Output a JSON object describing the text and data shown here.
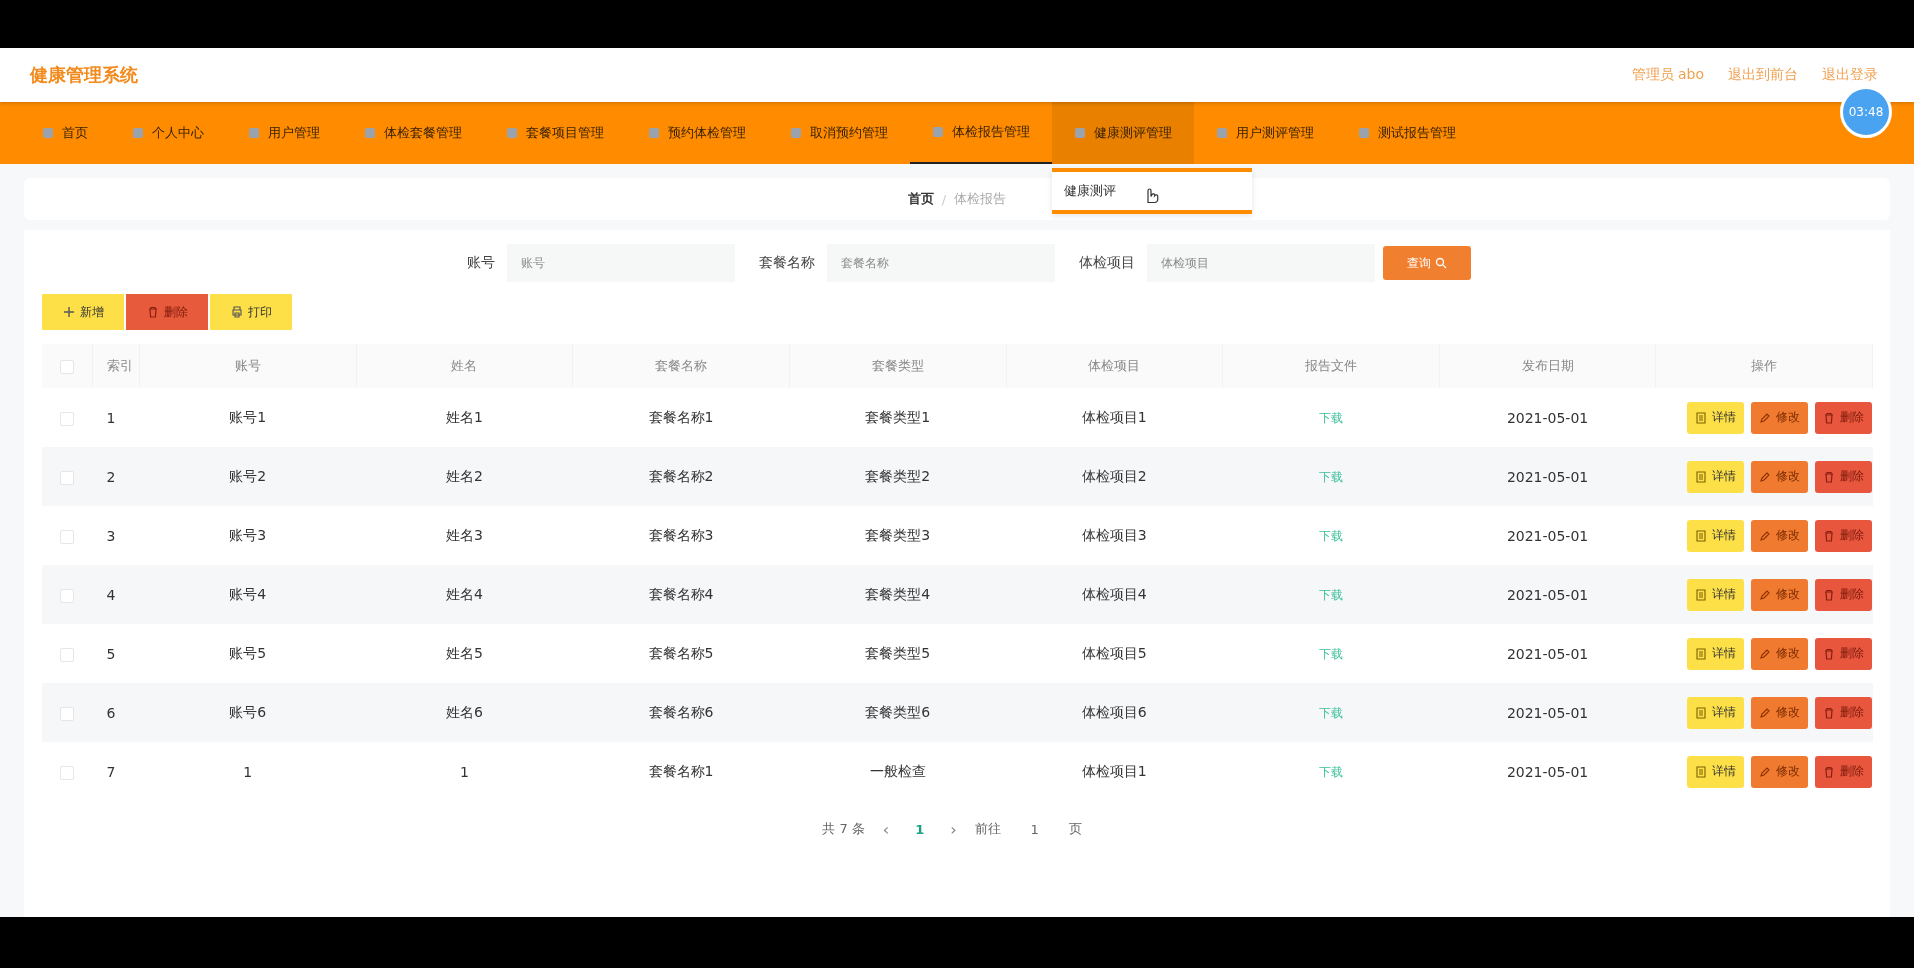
{
  "header": {
    "title": "健康管理系统",
    "links": [
      "管理员 abo",
      "退出到前台",
      "退出登录"
    ],
    "clock": "03:48"
  },
  "nav": {
    "items": [
      {
        "label": "首页",
        "selected": false,
        "hovered": false
      },
      {
        "label": "个人中心",
        "selected": false,
        "hovered": false
      },
      {
        "label": "用户管理",
        "selected": false,
        "hovered": false
      },
      {
        "label": "体检套餐管理",
        "selected": false,
        "hovered": false
      },
      {
        "label": "套餐项目管理",
        "selected": false,
        "hovered": false
      },
      {
        "label": "预约体检管理",
        "selected": false,
        "hovered": false
      },
      {
        "label": "取消预约管理",
        "selected": false,
        "hovered": false
      },
      {
        "label": "体检报告管理",
        "selected": true,
        "hovered": false
      },
      {
        "label": "健康测评管理",
        "selected": false,
        "hovered": true,
        "submenu": [
          "健康测评"
        ]
      },
      {
        "label": "用户测评管理",
        "selected": false,
        "hovered": false
      },
      {
        "label": "测试报告管理",
        "selected": false,
        "hovered": false
      }
    ]
  },
  "breadcrumb": {
    "items": [
      "首页",
      "体检报告"
    ],
    "separator": "/"
  },
  "search": {
    "fields": [
      {
        "label": "账号",
        "placeholder": "账号"
      },
      {
        "label": "套餐名称",
        "placeholder": "套餐名称"
      },
      {
        "label": "体检项目",
        "placeholder": "体检项目"
      }
    ],
    "button": "查询"
  },
  "toolbar": [
    {
      "kind": "add",
      "label": "新增"
    },
    {
      "kind": "delete",
      "label": "删除"
    },
    {
      "kind": "print",
      "label": "打印"
    }
  ],
  "table": {
    "all_selected": false,
    "columns": [
      "索引",
      "账号",
      "姓名",
      "套餐名称",
      "套餐类型",
      "体检项目",
      "报告文件",
      "发布日期",
      "操作"
    ],
    "rows": [
      {
        "selected": false,
        "cells": [
          "1",
          "账号1",
          "姓名1",
          "套餐名称1",
          "套餐类型1",
          "体检项目1"
        ],
        "file": "下载",
        "date": "2021-05-01"
      },
      {
        "selected": false,
        "cells": [
          "2",
          "账号2",
          "姓名2",
          "套餐名称2",
          "套餐类型2",
          "体检项目2"
        ],
        "file": "下载",
        "date": "2021-05-01"
      },
      {
        "selected": false,
        "cells": [
          "3",
          "账号3",
          "姓名3",
          "套餐名称3",
          "套餐类型3",
          "体检项目3"
        ],
        "file": "下载",
        "date": "2021-05-01"
      },
      {
        "selected": false,
        "cells": [
          "4",
          "账号4",
          "姓名4",
          "套餐名称4",
          "套餐类型4",
          "体检项目4"
        ],
        "file": "下载",
        "date": "2021-05-01"
      },
      {
        "selected": false,
        "cells": [
          "5",
          "账号5",
          "姓名5",
          "套餐名称5",
          "套餐类型5",
          "体检项目5"
        ],
        "file": "下载",
        "date": "2021-05-01"
      },
      {
        "selected": false,
        "cells": [
          "6",
          "账号6",
          "姓名6",
          "套餐名称6",
          "套餐类型6",
          "体检项目6"
        ],
        "file": "下载",
        "date": "2021-05-01"
      },
      {
        "selected": false,
        "cells": [
          "7",
          "1",
          "1",
          "套餐名称1",
          "一般检查",
          "体检项目1"
        ],
        "file": "下载",
        "date": "2021-05-01"
      }
    ],
    "row_actions": [
      [
        {
          "kind": "detail",
          "label": "详情"
        },
        {
          "kind": "edit",
          "label": "修改"
        },
        {
          "kind": "delete",
          "label": "删除"
        }
      ],
      [
        {
          "kind": "detail",
          "label": "详情"
        },
        {
          "kind": "edit",
          "label": "修改"
        },
        {
          "kind": "delete",
          "label": "删除"
        }
      ],
      [
        {
          "kind": "detail",
          "label": "详情"
        },
        {
          "kind": "edit",
          "label": "修改"
        },
        {
          "kind": "delete",
          "label": "删除"
        }
      ],
      [
        {
          "kind": "detail",
          "label": "详情"
        },
        {
          "kind": "edit",
          "label": "修改"
        },
        {
          "kind": "delete",
          "label": "删除"
        }
      ],
      [
        {
          "kind": "detail",
          "label": "详情"
        },
        {
          "kind": "edit",
          "label": "修改"
        },
        {
          "kind": "delete",
          "label": "删除"
        }
      ],
      [
        {
          "kind": "detail",
          "label": "详情"
        },
        {
          "kind": "edit",
          "label": "修改"
        },
        {
          "kind": "delete",
          "label": "删除"
        }
      ],
      [
        {
          "kind": "detail",
          "label": "详情"
        },
        {
          "kind": "edit",
          "label": "修改"
        },
        {
          "kind": "delete",
          "label": "删除"
        }
      ]
    ]
  },
  "pagination": {
    "total": "共 7 条",
    "prev": "‹",
    "next": "›",
    "pages": [
      {
        "label": "1",
        "selected": true
      }
    ],
    "goto_label": "前往",
    "goto_value": "1",
    "page_suffix": "页"
  }
}
